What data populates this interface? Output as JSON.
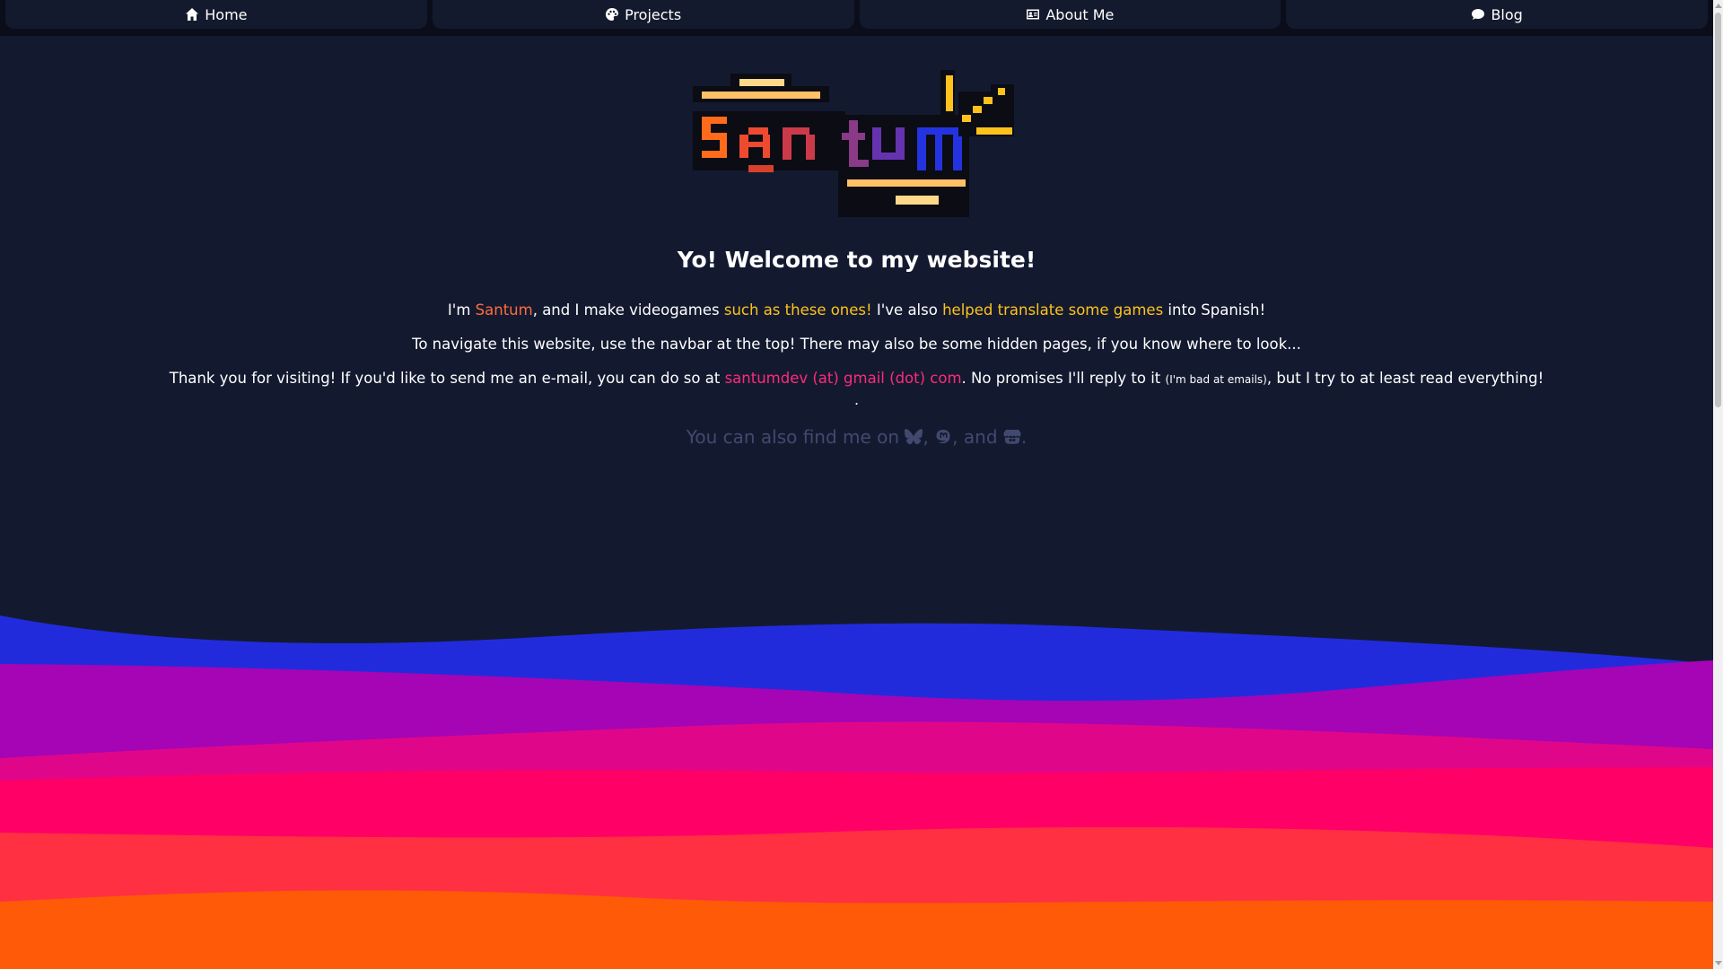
{
  "nav": {
    "items": [
      {
        "label": "Home",
        "icon": "home-icon"
      },
      {
        "label": "Projects",
        "icon": "palette-icon"
      },
      {
        "label": "About Me",
        "icon": "id-card-icon"
      },
      {
        "label": "Blog",
        "icon": "comment-icon"
      }
    ]
  },
  "logo": {
    "alt": "Santum"
  },
  "main": {
    "title": "Yo! Welcome to my website!",
    "intro": {
      "t1": "I'm ",
      "name": "Santum",
      "t2": ", and I make videogames ",
      "games_link": "such as these ones!",
      "t3": " I've also ",
      "translate_link": "helped translate some games",
      "t4": " into Spanish!"
    },
    "navigate_text": "To navigate this website, use the navbar at the top! There may also be some hidden pages, if you know where to look...",
    "contact": {
      "t1": "Thank you for visiting! If you'd like to send me an e-mail, you can do so at ",
      "email": "santumdev (at) gmail (dot) com",
      "t2": ". No promises I'll reply to it ",
      "small": "(I'm bad at emails)",
      "t3": ", but I try to at least read everything!"
    },
    "dot": ".",
    "social": {
      "t1": "You can also find me on ",
      "sep1": ", ",
      "sep2": ", and ",
      "end": ".",
      "icons": [
        "bluesky-icon",
        "mastodon-icon",
        "itchio-icon"
      ]
    }
  },
  "colors": {
    "background": "#131a30",
    "accent_orange": "#ff6b3d",
    "accent_gold": "#ffc21c",
    "accent_pink": "#ff2a7a",
    "wave_blue": "#222bdc",
    "wave_purple": "#a505b4",
    "wave_magenta": "#e0068a",
    "wave_pink": "#ff0066",
    "wave_red": "#ff3042",
    "wave_orange": "#ff5a08"
  }
}
